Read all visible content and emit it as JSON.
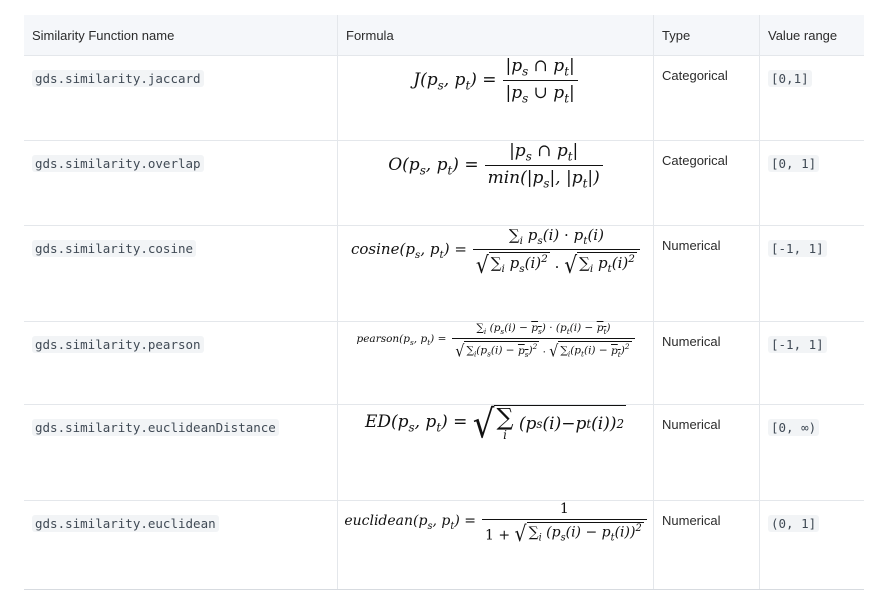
{
  "headers": {
    "name": "Similarity Function name",
    "formula": "Formula",
    "type": "Type",
    "range": "Value range"
  },
  "rows": [
    {
      "name": "gds.similarity.jaccard",
      "type": "Categorical",
      "range": "[0,1]"
    },
    {
      "name": "gds.similarity.overlap",
      "type": "Categorical",
      "range": "[0, 1]"
    },
    {
      "name": "gds.similarity.cosine",
      "type": "Numerical",
      "range": "[-1, 1]"
    },
    {
      "name": "gds.similarity.pearson",
      "type": "Numerical",
      "range": "[-1, 1]"
    },
    {
      "name": "gds.similarity.euclideanDistance",
      "type": "Numerical",
      "range": "[0, ∞)"
    },
    {
      "name": "gds.similarity.euclidean",
      "type": "Numerical",
      "range": "(0, 1]"
    }
  ],
  "formulas": {
    "jaccard": {
      "lhs": "J(p",
      "num": "|p",
      "den": "|p"
    },
    "overlap": {
      "lhs": "O(p",
      "den_prefix": "min("
    },
    "cosine": {
      "lhs": "cosine(p"
    },
    "pearson": {
      "lhs": "pearson(p"
    },
    "euclideanDistance": {
      "lhs": "ED(p"
    },
    "euclidean": {
      "lhs": "euclidean(p",
      "num": "1",
      "den_prefix": "1 + "
    }
  }
}
